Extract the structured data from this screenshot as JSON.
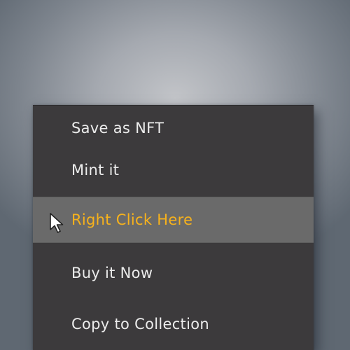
{
  "context_menu": {
    "items": [
      {
        "label": "Save as NFT"
      },
      {
        "label": "Mint it"
      },
      {
        "label": "Right Click Here",
        "highlighted": true
      },
      {
        "label": "Buy it Now"
      },
      {
        "label": "Copy to Collection"
      }
    ],
    "highlight_text_color": "#f7b21c",
    "highlight_bg_color": "#6a6a6a",
    "menu_bg_color": "#3c3a3c"
  },
  "cursor": {
    "icon": "mouse-pointer-icon"
  }
}
